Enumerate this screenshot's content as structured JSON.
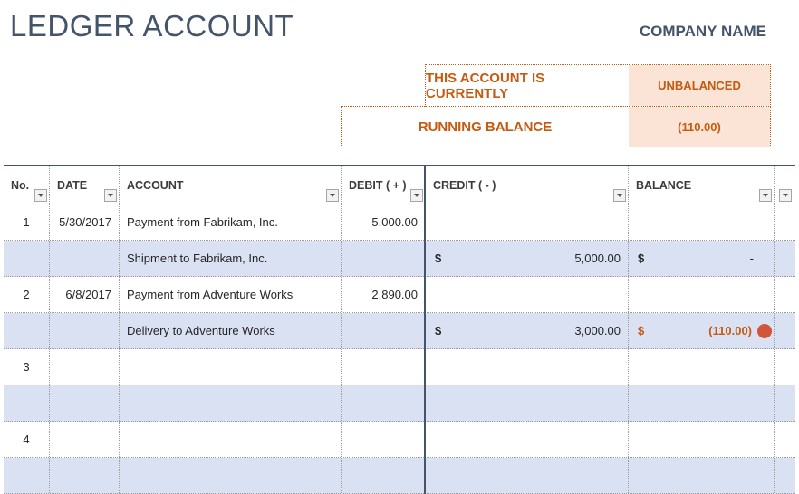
{
  "header": {
    "title": "LEDGER ACCOUNT",
    "company": "COMPANY NAME"
  },
  "status": {
    "current_label": "THIS ACCOUNT IS CURRENTLY",
    "current_value": "UNBALANCED",
    "balance_label": "RUNNING BALANCE",
    "balance_value": "(110.00)"
  },
  "table": {
    "columns": [
      "No.",
      "DATE",
      "ACCOUNT",
      "DEBIT ( + )",
      "CREDIT ( - )",
      "BALANCE"
    ],
    "rows": [
      {
        "no": "1",
        "date": "5/30/2017",
        "account": "Payment from Fabrikam, Inc.",
        "debit": "5,000.00",
        "credit_symbol": "",
        "credit": "",
        "balance_symbol": "",
        "balance": ""
      },
      {
        "no": "",
        "date": "",
        "account": "Shipment to Fabrikam, Inc.",
        "debit": "",
        "credit_symbol": "$",
        "credit": "5,000.00",
        "balance_symbol": "$",
        "balance": "-"
      },
      {
        "no": "2",
        "date": "6/8/2017",
        "account": "Payment from Adventure Works",
        "debit": "2,890.00",
        "credit_symbol": "",
        "credit": "",
        "balance_symbol": "",
        "balance": ""
      },
      {
        "no": "",
        "date": "",
        "account": "Delivery to Adventure Works",
        "debit": "",
        "credit_symbol": "$",
        "credit": "3,000.00",
        "balance_symbol": "$",
        "balance": "(110.00)"
      },
      {
        "no": "3",
        "date": "",
        "account": "",
        "debit": "",
        "credit_symbol": "",
        "credit": "",
        "balance_symbol": "",
        "balance": ""
      },
      {
        "no": "",
        "date": "",
        "account": "",
        "debit": "",
        "credit_symbol": "",
        "credit": "",
        "balance_symbol": "",
        "balance": ""
      },
      {
        "no": "4",
        "date": "",
        "account": "",
        "debit": "",
        "credit_symbol": "",
        "credit": "",
        "balance_symbol": "",
        "balance": ""
      },
      {
        "no": "",
        "date": "",
        "account": "",
        "debit": "",
        "credit_symbol": "",
        "credit": "",
        "balance_symbol": "",
        "balance": ""
      }
    ]
  },
  "colors": {
    "accent": "#44546a",
    "warning": "#c55a11",
    "warning_fill": "#fbe4d5",
    "row_alt": "#dae1f3",
    "indicator": "#d2553a"
  }
}
